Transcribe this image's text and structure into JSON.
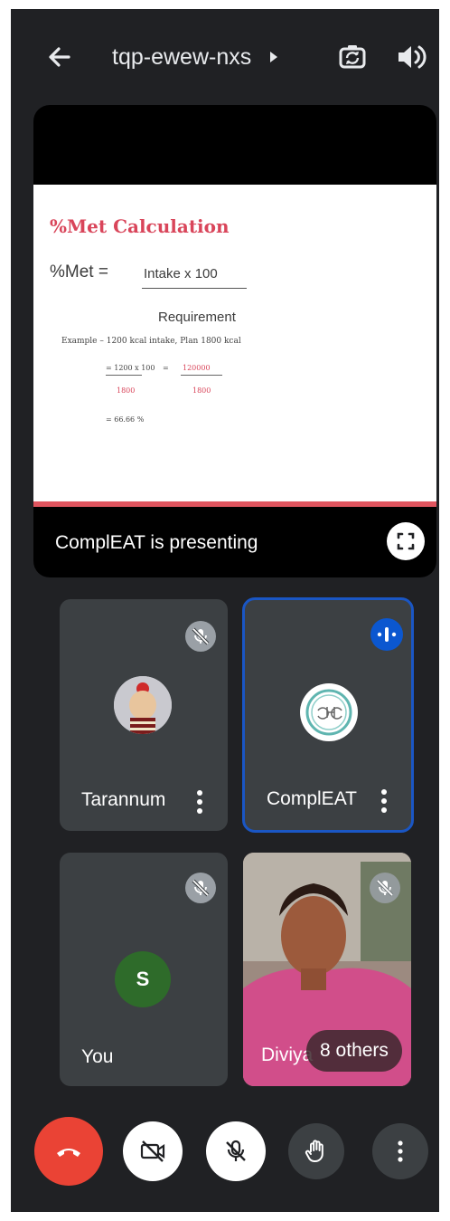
{
  "topbar": {
    "meeting_code": "tqp-ewew-nxs",
    "icons": [
      "arrow-back-icon",
      "chevron-right-icon",
      "switch-camera-icon",
      "speaker-icon"
    ]
  },
  "presentation": {
    "slide": {
      "title": "%Met Calculation",
      "formula_lhs": "%Met =",
      "numerator": "Intake x 100",
      "denominator": "Requirement",
      "example": "Example – 1200 kcal intake, Plan 1800 kcal",
      "calc_numerator": "= 1200 x 100",
      "calc_equals": "=",
      "calc_numerator_2": "120000",
      "calc_denominator_1": "1800",
      "calc_denominator_2": "1800",
      "result": "= 66.66 %"
    },
    "presenter_label": "ComplEAT is presenting",
    "fullscreen_icon": "fullscreen-icon"
  },
  "participants": [
    {
      "name": "Tarannum",
      "muted": true
    },
    {
      "name": "ComplEAT",
      "muted": false,
      "speaking": true
    },
    {
      "name": "You",
      "avatar_letter": "S",
      "muted": true
    },
    {
      "name": "Diviya",
      "muted": true,
      "others_label": "8 others"
    }
  ],
  "controls": {
    "icons": [
      "end-call-icon",
      "camera-off-icon",
      "mic-off-icon",
      "raise-hand-icon",
      "more-vert-icon"
    ]
  },
  "colors": {
    "background": "#202124",
    "tile": "#3c4043",
    "end_call": "#ea4335",
    "active_speaker_border": "#1a56c4",
    "slide_accent": "#d9455a",
    "you_avatar": "#2e6b2a"
  }
}
